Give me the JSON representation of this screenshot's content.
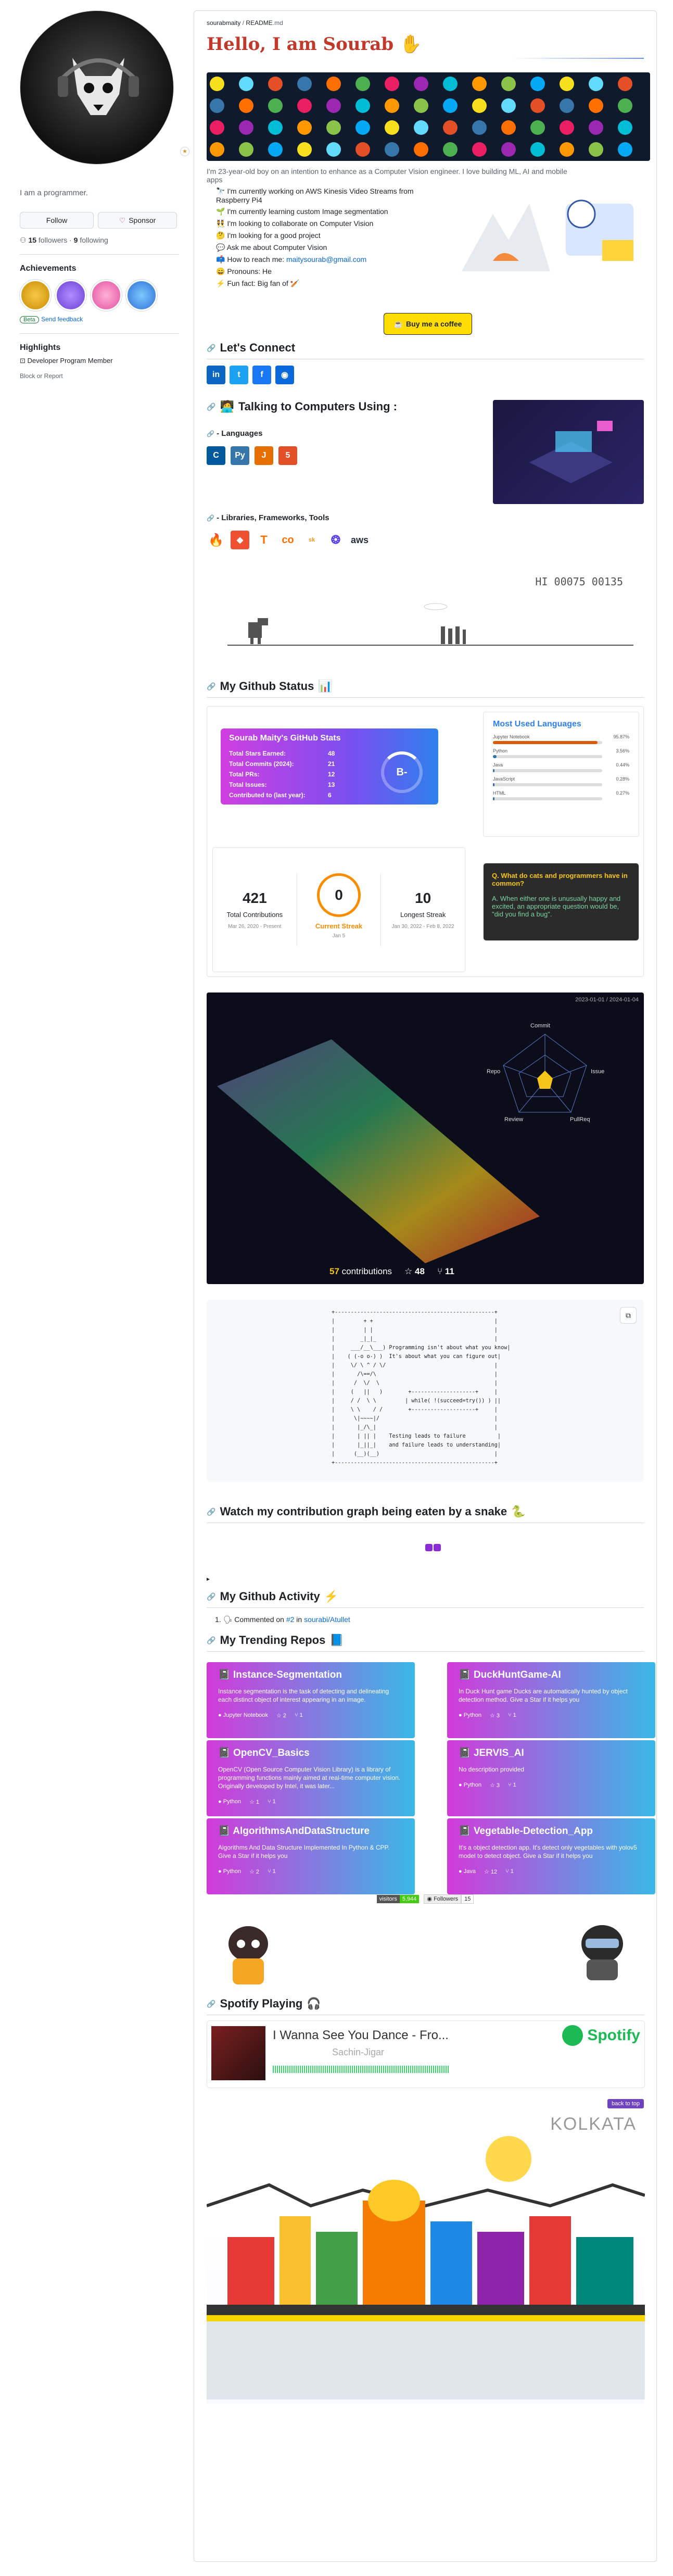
{
  "profile": {
    "bio": "I am a programmer.",
    "follow_label": "Follow",
    "sponsor_label": "Sponsor",
    "followers_count": "15",
    "followers_label": "followers",
    "following_count": "9",
    "following_label": "following"
  },
  "achievements": {
    "heading": "Achievements",
    "beta": "Beta",
    "feedback": "Send feedback",
    "x2": "x2"
  },
  "highlights": {
    "heading": "Highlights",
    "item": "Developer Program Member",
    "block": "Block or Report"
  },
  "breadcrumb": {
    "owner": "sourabmaity",
    "sep": "/",
    "file": "README",
    "ext": ".md"
  },
  "readme": {
    "title": "Hello, I am Sourab",
    "intro": "I'm 23-year-old boy on an intention to enhance as a Computer Vision engineer. I love building ML, AI and mobile apps",
    "bullets": [
      "I'm currently working on AWS Kinesis Video Streams from Raspberry Pi4",
      "I'm currently learning custom Image segmentation",
      "I'm looking to collaborate on Computer Vision",
      "I'm looking for a good project",
      "Ask me about Computer Vision",
      "How to reach me: ",
      "Pronouns: He",
      "Fun fact: Big fan of"
    ],
    "email": "maitysourab@gmail.com",
    "coffee": "Buy me a coffee",
    "connect": "Let's Connect",
    "talking": "Talking to Computers Using :",
    "languages": "- Languages",
    "libs": "- Libraries, Frameworks, Tools",
    "dino_score": "HI 00075 00135",
    "github_status": "My Github Status",
    "snake": "Watch my contribution graph being eaten by a snake",
    "activity": "My Github Activity",
    "activity_item": "Commented on ",
    "activity_issue": "#2",
    "activity_in": " in ",
    "activity_repo": "sourabi/Atullet",
    "trending": "My Trending Repos",
    "spotify": "Spotify Playing",
    "back_to_top": "back to top",
    "kolkata": "KOLKATA"
  },
  "stats": {
    "title": "Sourab Maity's GitHub Stats",
    "rows": [
      [
        "Total Stars Earned:",
        "48"
      ],
      [
        "Total Commits (2024):",
        "21"
      ],
      [
        "Total PRs:",
        "12"
      ],
      [
        "Total Issues:",
        "13"
      ],
      [
        "Contributed to (last year):",
        "6"
      ]
    ],
    "grade": "B-"
  },
  "langs": {
    "title": "Most Used Languages",
    "items": [
      [
        "Jupyter Notebook",
        "95.87%"
      ],
      [
        "Python",
        "3.56%"
      ],
      [
        "Java",
        "0.44%"
      ],
      [
        "JavaScript",
        "0.28%"
      ],
      [
        "HTML",
        "0.27%"
      ]
    ]
  },
  "streak": {
    "total": "421",
    "total_label": "Total Contributions",
    "total_range": "Mar 26, 2020 - Present",
    "current": "0",
    "current_label": "Current Streak",
    "current_range": "Jan 5",
    "longest": "10",
    "longest_label": "Longest Streak",
    "longest_range": "Jan 30, 2022 - Feb 8, 2022"
  },
  "joke": {
    "q": "Q. What do cats and programmers have in common?",
    "a": "A. When either one is unusually happy and excited, an appropriate question would be, \"did you find a bug\"."
  },
  "iso": {
    "range": "2023-01-01 / 2024-01-04",
    "contrib": "57",
    "contrib_label": "contributions",
    "stars": "48",
    "forks": "11",
    "radar": [
      "Commit",
      "Issue",
      "PullReq",
      "Review",
      "Repo"
    ]
  },
  "ascii": "+--------------------------------------------------+\n|         + +                                      |\n|         | |                                      |\n|        _|_|_                                     |\n|     ___/__\\___) Programming isn't about what you know|\n|    ( (-o o-) )  It's about what you can figure out|\n|     \\/ \\ ^ / \\/                                  |\n|       /\\==/\\                                     |\n|      /  \\/  \\                                    |\n|     (   ||   )        +--------------------+     |\n|     / /  \\ \\         | while( !(succeed=try()) ) ||\n|     \\ \\    / /        +--------------------+     |\n|      \\|~~~~|/                                    |\n|       |_/\\_|                                     |\n|       | || |    Testing leads to failure          |\n|       |_||_|    and failure leads to understanding|\n|      (__)(__)                                    |\n+--------------------------------------------------+",
  "repos": [
    {
      "name": "Instance-Segmentation",
      "desc": "Instance segmentation is the task of detecting and delineating each distinct object of interest appearing in an image.",
      "lang": "Jupyter Notebook",
      "stars": "2",
      "forks": "1"
    },
    {
      "name": "DuckHuntGame-AI",
      "desc": "In Duck Hunt game Ducks are automatically hunted by object detection method. Give a Star if it helps you",
      "lang": "Python",
      "stars": "3",
      "forks": "1"
    },
    {
      "name": "OpenCV_Basics",
      "desc": "OpenCV (Open Source Computer Vision Library) is a library of programming functions mainly aimed at real-time computer vision. Originally developed by Intel, it was later...",
      "lang": "Python",
      "stars": "1",
      "forks": "1"
    },
    {
      "name": "JERVIS_AI",
      "desc": "No description provided",
      "lang": "Python",
      "stars": "3",
      "forks": "1"
    },
    {
      "name": "AlgorithmsAndDataStructure",
      "desc": "Algorithms And Data Structure Implemented In Python & CPP. Give a Star if it helps you",
      "lang": "Python",
      "stars": "2",
      "forks": "1"
    },
    {
      "name": "Vegetable-Detection_App",
      "desc": "It's a object detection app. It's detect only vegetables with yolov5 model to detect object. Give a Star if it helps you",
      "lang": "Java",
      "stars": "12",
      "forks": "1"
    }
  ],
  "visitors": {
    "label": "visitors",
    "count": "5,944",
    "followers_label": "Followers",
    "followers": "15"
  },
  "song": {
    "title": "I Wanna See You Dance - Fro...",
    "artist": "Sachin-Jigar",
    "brand": "Spotify"
  },
  "colors": {
    "accent": "#0969da",
    "title": "#c0392b",
    "grad_a": "#d23ad9",
    "grad_b": "#3ab8e6"
  }
}
